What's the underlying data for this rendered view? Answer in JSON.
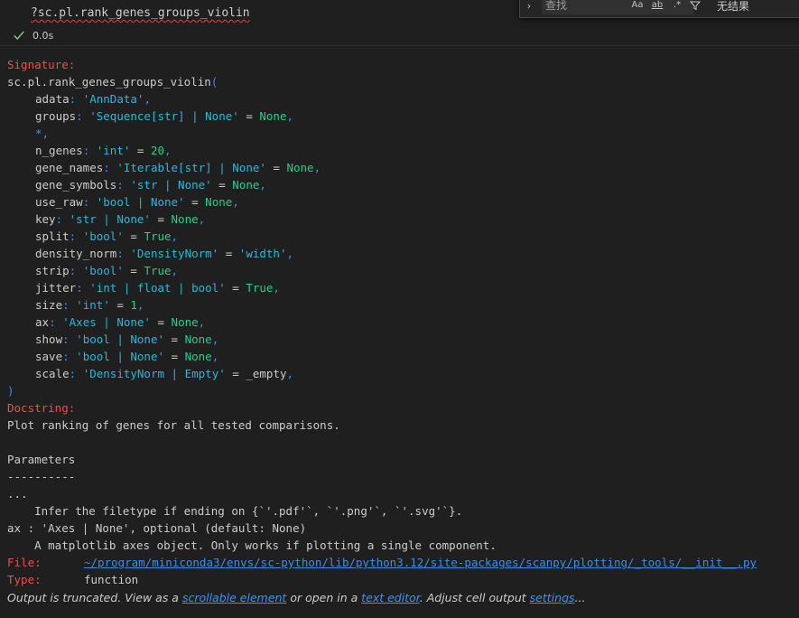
{
  "cell": {
    "code": "?sc.pl.rank_genes_groups_violin",
    "exec_time": "0.0s"
  },
  "find": {
    "placeholder": "查找",
    "opt_case": "Aa",
    "opt_word": "ab",
    "opt_regex": ".*",
    "no_results": "无结果"
  },
  "signature": {
    "header": "Signature:",
    "call": "sc.pl.rank_genes_groups_violin",
    "open_paren": "(",
    "close_paren": ")",
    "params": [
      {
        "name": "adata",
        "type": "'AnnData'",
        "default": ""
      },
      {
        "name": "groups",
        "type": "'Sequence[str] | None'",
        "default": "None"
      },
      {
        "name": "*",
        "type": "",
        "default": ""
      },
      {
        "name": "n_genes",
        "type": "'int'",
        "default": "20"
      },
      {
        "name": "gene_names",
        "type": "'Iterable[str] | None'",
        "default": "None"
      },
      {
        "name": "gene_symbols",
        "type": "'str | None'",
        "default": "None"
      },
      {
        "name": "use_raw",
        "type": "'bool | None'",
        "default": "None"
      },
      {
        "name": "key",
        "type": "'str | None'",
        "default": "None"
      },
      {
        "name": "split",
        "type": "'bool'",
        "default": "True"
      },
      {
        "name": "density_norm",
        "type": "'DensityNorm'",
        "default": "'width'"
      },
      {
        "name": "strip",
        "type": "'bool'",
        "default": "True"
      },
      {
        "name": "jitter",
        "type": "'int | float | bool'",
        "default": "True"
      },
      {
        "name": "size",
        "type": "'int'",
        "default": "1"
      },
      {
        "name": "ax",
        "type": "'Axes | None'",
        "default": "None"
      },
      {
        "name": "show",
        "type": "'bool | None'",
        "default": "None"
      },
      {
        "name": "save",
        "type": "'bool | None'",
        "default": "None"
      },
      {
        "name": "scale",
        "type": "'DensityNorm | Empty'",
        "default": "_empty"
      }
    ]
  },
  "docstring": {
    "header": "Docstring:",
    "summary": "Plot ranking of genes for all tested comparisons.",
    "params_header": "Parameters",
    "rule": "----------",
    "ellipsis": "...",
    "filetype_line": "    Infer the filetype if ending on {`'.pdf'`, `'.png'`, `'.svg'`}.",
    "ax_line": "ax : 'Axes | None', optional (default: None)",
    "ax_desc": "    A matplotlib axes object. Only works if plotting a single component."
  },
  "meta": {
    "file_label": "File:",
    "file_path": "~/program/miniconda3/envs/sc-python/lib/python3.12/site-packages/scanpy/plotting/_tools/__init__.py",
    "type_label": "Type:",
    "type_value": "function"
  },
  "footer": {
    "prefix": "Output is truncated. View as a ",
    "link1": "scrollable element",
    "mid": " or open in a ",
    "link2": "text editor",
    "mid2": ". Adjust cell output ",
    "link3": "settings",
    "suffix": "..."
  },
  "colors": {
    "background": "#1f1f1f",
    "header_red": "#f14c4c",
    "type_blue": "#3b8eea",
    "value_green": "#23d18b"
  }
}
